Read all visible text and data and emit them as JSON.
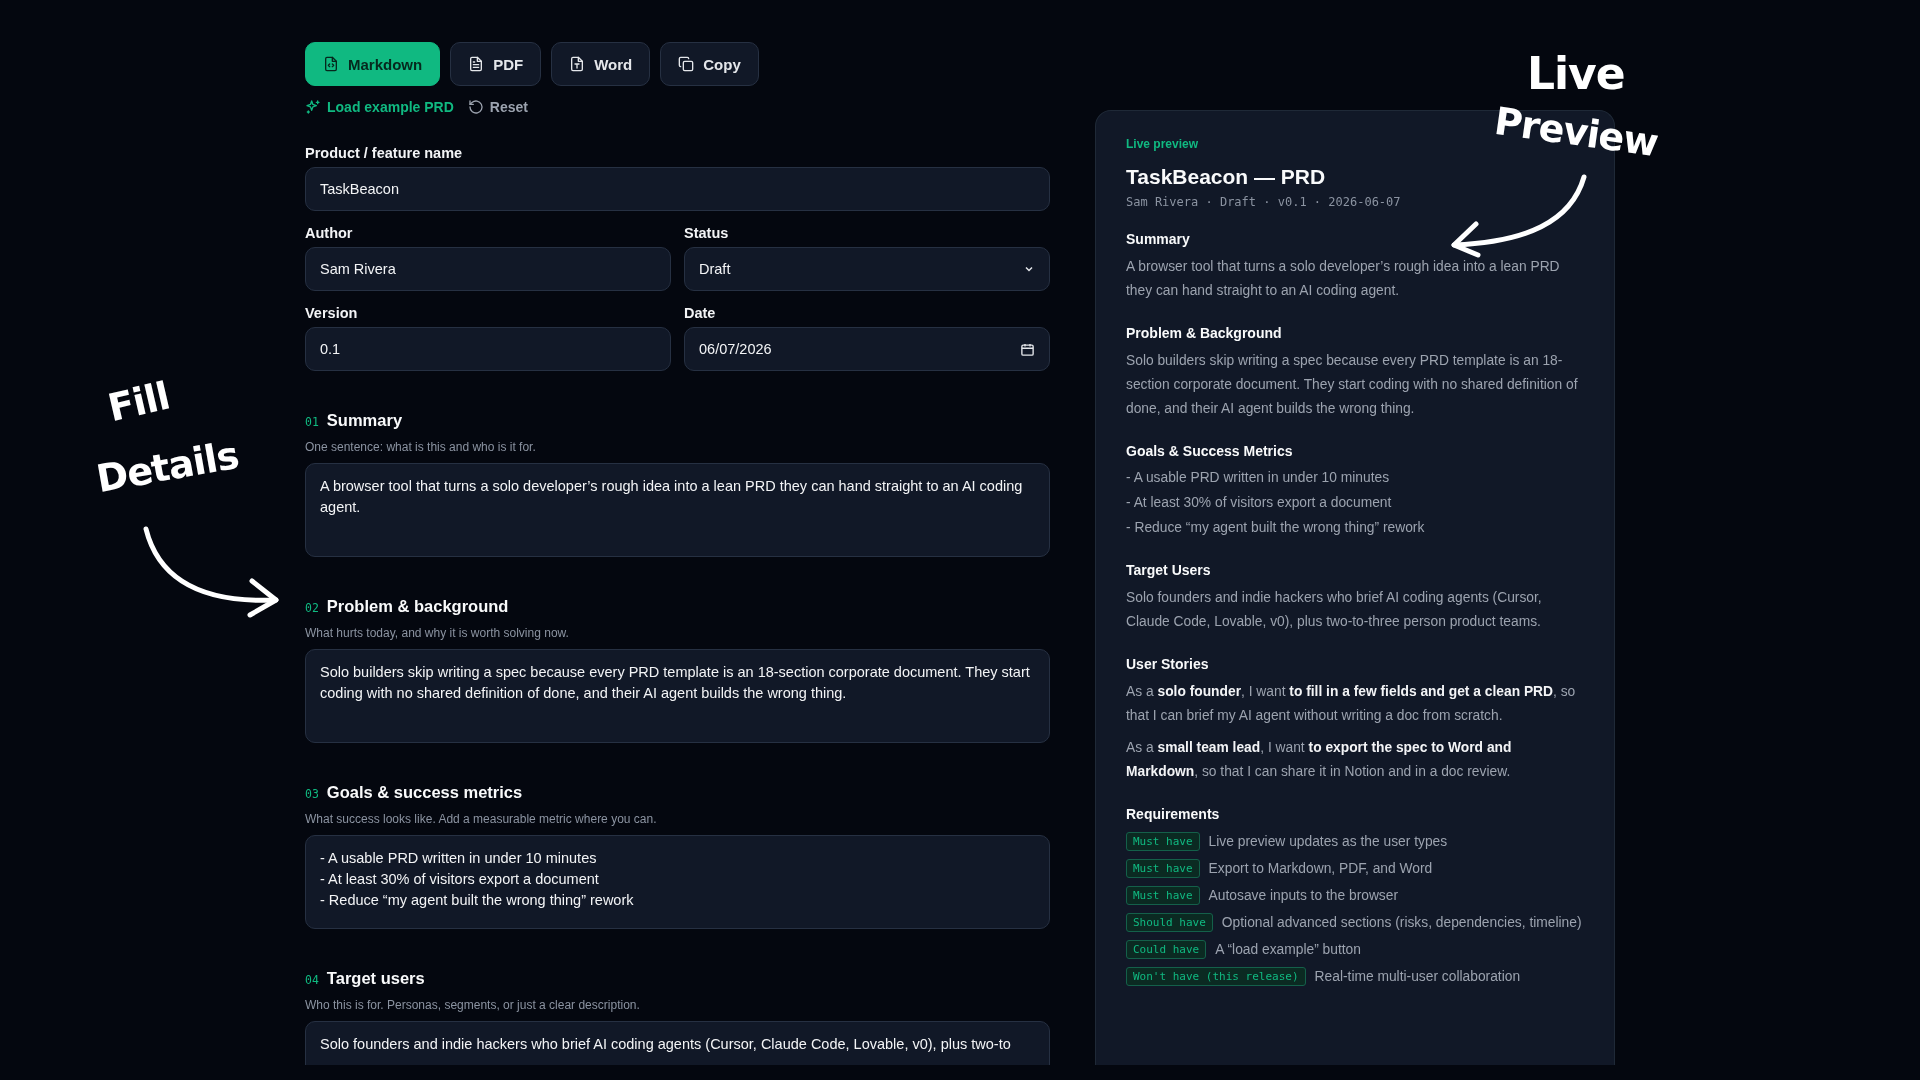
{
  "export_buttons": [
    {
      "label": "Markdown",
      "kind": "code",
      "selected": true
    },
    {
      "label": "PDF",
      "kind": "text",
      "selected": false
    },
    {
      "label": "Word",
      "kind": "type",
      "selected": false
    },
    {
      "label": "Copy",
      "kind": "copy",
      "selected": false
    }
  ],
  "actions": [
    {
      "label": "Load example PRD",
      "kind": "sparkle"
    },
    {
      "label": "Reset",
      "kind": "reset"
    }
  ],
  "fields": [
    {
      "label": "Product / feature name",
      "value": "TaskBeacon",
      "kind": "text"
    },
    {
      "label": "Author",
      "value": "Sam Rivera",
      "kind": "text"
    },
    {
      "label": "Status",
      "value": "Draft",
      "kind": "select"
    },
    {
      "label": "Version",
      "value": "0.1",
      "kind": "text"
    },
    {
      "label": "Date",
      "value": "06/07/2026",
      "kind": "date"
    }
  ],
  "sections": [
    {
      "number": "01",
      "title": "Summary",
      "hint": "One sentence: what is this and who is it for.",
      "value": "A browser tool that turns a solo developer’s rough idea into a lean PRD they can hand straight to an AI coding agent."
    },
    {
      "number": "02",
      "title": "Problem & background",
      "hint": "What hurts today, and why it is worth solving now.",
      "value": "Solo builders skip writing a spec because every PRD template is an 18-section corporate document. They start coding with no shared definition of done, and their AI agent builds the wrong thing."
    },
    {
      "number": "03",
      "title": "Goals & success metrics",
      "hint": "What success looks like. Add a measurable metric where you can.",
      "value": "- A usable PRD written in under 10 minutes\n- At least 30% of visitors export a document\n- Reduce “my agent built the wrong thing” rework"
    },
    {
      "number": "04",
      "title": "Target users",
      "hint": "Who this is for. Personas, segments, or just a clear description.",
      "value": "Solo founders and indie hackers who brief AI coding agents (Cursor, Claude Code, Lovable, v0), plus two-to"
    }
  ],
  "preview": {
    "eyebrow": "Live preview",
    "title": "TaskBeacon — PRD",
    "meta": "Sam Rivera · Draft · v0.1 · 2026-06-07",
    "blocks": [
      {
        "heading": "Summary",
        "kind": "paragraph",
        "lines": [
          "A browser tool that turns a solo developer’s rough idea into a lean PRD they can hand straight to an AI coding agent."
        ]
      },
      {
        "heading": "Problem & Background",
        "kind": "paragraph",
        "lines": [
          "Solo builders skip writing a spec because every PRD template is an 18-section corporate document. They start coding with no shared definition of done, and their AI agent builds the wrong thing."
        ]
      },
      {
        "heading": "Goals & Success Metrics",
        "kind": "list",
        "lines": [
          "- A usable PRD written in under 10 minutes",
          "- At least 30% of visitors export a document",
          "- Reduce “my agent built the wrong thing” rework"
        ]
      },
      {
        "heading": "Target Users",
        "kind": "paragraph",
        "lines": [
          "Solo founders and indie hackers who brief AI coding agents (Cursor, Claude Code, Lovable, v0), plus two-to-three person product teams."
        ]
      },
      {
        "heading": "User Stories",
        "kind": "stories",
        "lines": [
          "As a **solo founder**, I want **to fill in a few fields and get a clean PRD**, so that I can brief my AI agent without writing a doc from scratch.",
          "As a **small team lead**, I want **to export the spec to Word and Markdown**, so that I can share it in Notion and in a doc review."
        ]
      },
      {
        "heading": "Requirements",
        "kind": "requirements",
        "items": [
          {
            "tag": "Must have",
            "text": "Live preview updates as the user types"
          },
          {
            "tag": "Must have",
            "text": "Export to Markdown, PDF, and Word"
          },
          {
            "tag": "Must have",
            "text": "Autosave inputs to the browser"
          },
          {
            "tag": "Should have",
            "text": "Optional advanced sections (risks, dependencies, timeline)"
          },
          {
            "tag": "Could have",
            "text": "A “load example” button"
          },
          {
            "tag": "Won't have (this release)",
            "text": "Real-time multi-user collaboration"
          }
        ]
      }
    ]
  },
  "annotations": [
    {
      "kind": "left",
      "lines": [
        "Fill",
        "Details"
      ]
    },
    {
      "kind": "right",
      "lines": [
        "Live",
        "Preview"
      ]
    }
  ]
}
